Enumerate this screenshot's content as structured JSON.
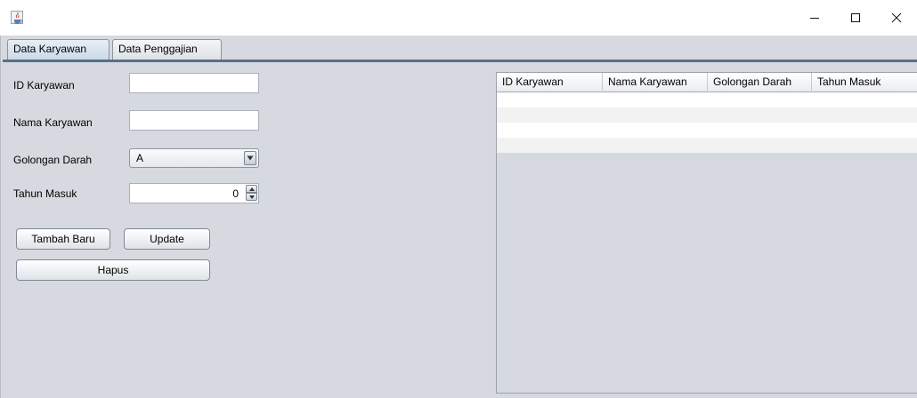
{
  "window": {
    "title": "",
    "app_icon": "java-cup-icon",
    "controls": [
      "minimize-icon",
      "maximize-icon",
      "close-icon"
    ]
  },
  "tabs": [
    {
      "label": "Data Karyawan",
      "selected": true
    },
    {
      "label": "Data Penggajian",
      "selected": false
    }
  ],
  "form": {
    "id_label": "ID Karyawan",
    "id_value": "",
    "nama_label": "Nama Karyawan",
    "nama_value": "",
    "golongan_label": "Golongan Darah",
    "golongan_value": "A",
    "tahun_label": "Tahun Masuk",
    "tahun_value": "0"
  },
  "buttons": {
    "tambah": "Tambah Baru",
    "update": "Update",
    "hapus": "Hapus"
  },
  "table": {
    "columns": [
      "ID Karyawan",
      "Nama Karyawan",
      "Golongan Darah",
      "Tahun Masuk"
    ],
    "rows": [
      [
        "",
        "",
        "",
        ""
      ],
      [
        "",
        "",
        "",
        ""
      ],
      [
        "",
        "",
        "",
        ""
      ],
      [
        "",
        "",
        "",
        ""
      ]
    ]
  },
  "colors": {
    "panel_background": "#d6d9df",
    "tab_underline": "#58708a",
    "row_alternate": "#f2f2f2"
  }
}
